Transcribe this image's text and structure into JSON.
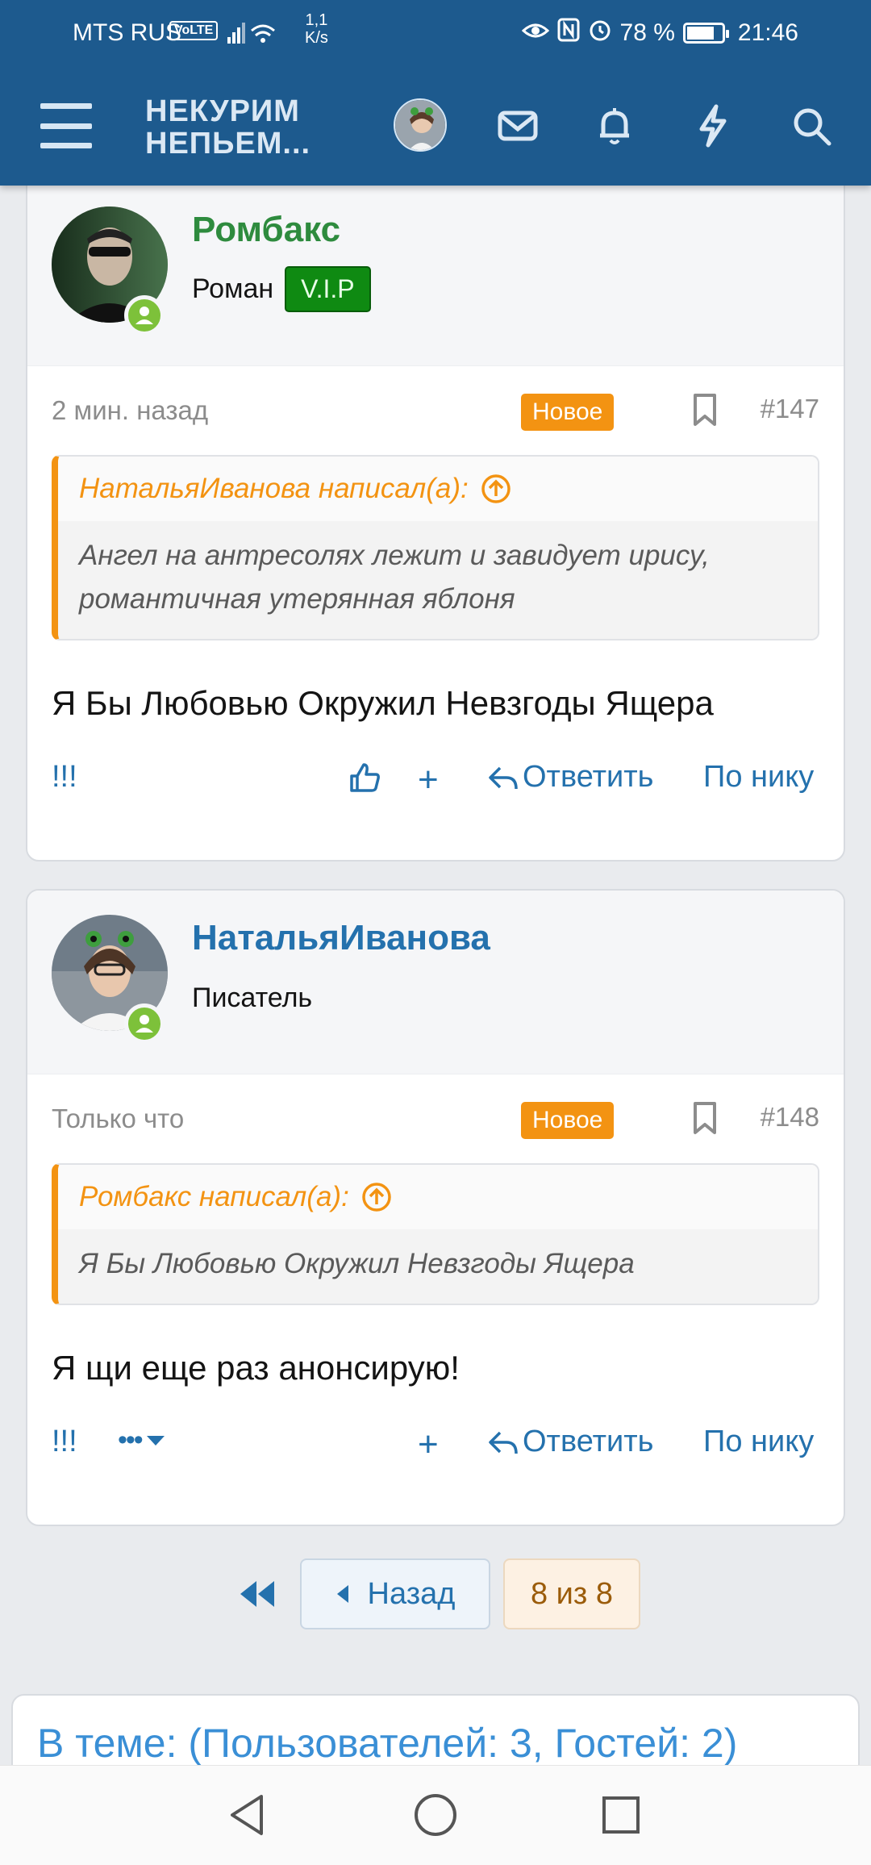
{
  "status_bar": {
    "carrier": "MTS RUS",
    "volte": "VoLTE",
    "speed_value": "1,1",
    "speed_unit": "K/s",
    "battery": "78 %",
    "battery_level": 0.78,
    "time": "21:46"
  },
  "header": {
    "logo_line1": "НЕКУРИМ",
    "logo_line2": "НЕПЬЕМ...",
    "icons": [
      "menu-icon",
      "mail-icon",
      "bell-icon",
      "lightning-icon",
      "search-icon"
    ]
  },
  "posts": [
    {
      "username": "Ромбакс",
      "username_color": "#2e8b3e",
      "user_title": "Роман",
      "badge": "V.I.P",
      "date": "2 мин. назад",
      "new_label": "Новое",
      "number": "#147",
      "quote_author": "НатальяИванова написал(а):",
      "quote_text": "Ангел на антресолях лежит и завидует ирису, романтичная утерянная яблоня",
      "message": "Я Бы Любовью Окружил Невзгоды Ящера",
      "actions": {
        "marks": "!!!",
        "plus": "+",
        "reply": "Ответить",
        "by_nick": "По нику"
      }
    },
    {
      "username": "НатальяИванова",
      "username_color": "#2471ad",
      "user_title": "Писатель",
      "date": "Только что",
      "new_label": "Новое",
      "number": "#148",
      "quote_author": "Ромбакс написал(а):",
      "quote_text": "Я Бы Любовью Окружил Невзгоды Ящера",
      "message": "Я щи еще раз анонсирую!",
      "actions": {
        "marks": "!!!",
        "more": "•••",
        "plus": "+",
        "reply": "Ответить",
        "by_nick": "По нику"
      }
    }
  ],
  "pagination": {
    "prev": "Назад",
    "current": "8 из 8"
  },
  "online": {
    "title": "В теме: (Пользователей: 3, Гостей: 2)"
  },
  "colors": {
    "brand": "#1d5a8e",
    "accent": "#f39312",
    "link": "#2471ad",
    "online": "#7dc13a"
  }
}
